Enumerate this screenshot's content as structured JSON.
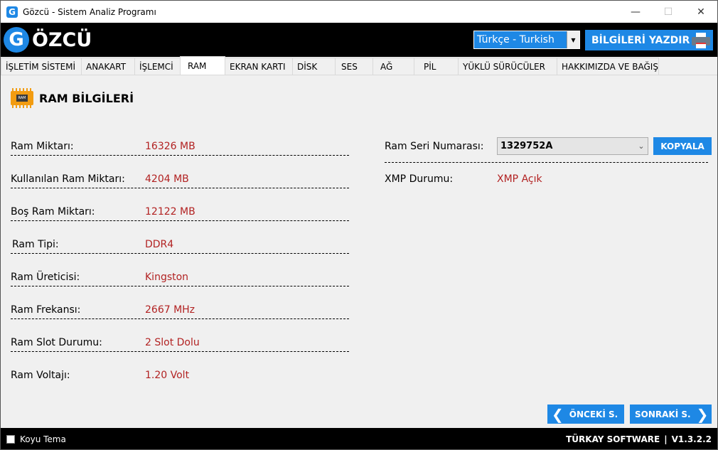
{
  "window": {
    "title": "Gözcü - Sistem Analiz Programı",
    "icon_letter": "G",
    "controls": [
      "—",
      "☐",
      "✕"
    ]
  },
  "header": {
    "logo_letter": "G",
    "logo_text": "ÖZCÜ",
    "language": "Türkçe - Turkish",
    "print_label": "BİLGİLERİ YAZDIR"
  },
  "tabs": [
    {
      "label": "İŞLETİM SİSTEMİ",
      "active": false
    },
    {
      "label": "ANAKART",
      "active": false
    },
    {
      "label": "İŞLEMCİ",
      "active": false
    },
    {
      "label": "RAM",
      "active": true
    },
    {
      "label": "EKRAN KARTI",
      "active": false
    },
    {
      "label": "DİSK",
      "active": false
    },
    {
      "label": "SES",
      "active": false
    },
    {
      "label": "AĞ",
      "active": false
    },
    {
      "label": "PİL",
      "active": false
    },
    {
      "label": "YÜKLÜ SÜRÜCÜLER",
      "active": false
    },
    {
      "label": "HAKKIMIZDA VE BAĞIŞ",
      "active": false
    }
  ],
  "section": {
    "title": "RAM BİLGİLERİ",
    "icon_text": "RAM"
  },
  "rows": [
    {
      "label": "Ram Miktarı:",
      "value": "16326 MB"
    },
    {
      "label": "Kullanılan Ram Miktarı:",
      "value": "4204 MB"
    },
    {
      "label": "Boş Ram Miktarı:",
      "value": "12122 MB"
    },
    {
      "label": "Ram Tipi:",
      "value": "DDR4"
    },
    {
      "label": "Ram Üreticisi:",
      "value": "Kingston"
    },
    {
      "label": "Ram Frekansı:",
      "value": "2667 MHz"
    },
    {
      "label": "Ram Slot Durumu:",
      "value": "2 Slot Dolu"
    },
    {
      "label": "Ram Voltajı:",
      "value": "1.20 Volt"
    }
  ],
  "serial": {
    "label": "Ram Seri Numarası:",
    "value": "1329752A",
    "copy_label": "KOPYALA"
  },
  "xmp": {
    "label": "XMP Durumu:",
    "value": "XMP Açık"
  },
  "nav": {
    "prev_label": "ÖNCEKİ S.",
    "next_label": "SONRAKİ S."
  },
  "footer": {
    "dark_theme_label": "Koyu Tema",
    "dark_theme_checked": false,
    "company": "TÜRKAY SOFTWARE",
    "separator": "|",
    "version": "V1.3.2.2"
  },
  "colors": {
    "accent": "#1e88e5",
    "value_red": "#b22222",
    "header_bg": "#000000"
  }
}
